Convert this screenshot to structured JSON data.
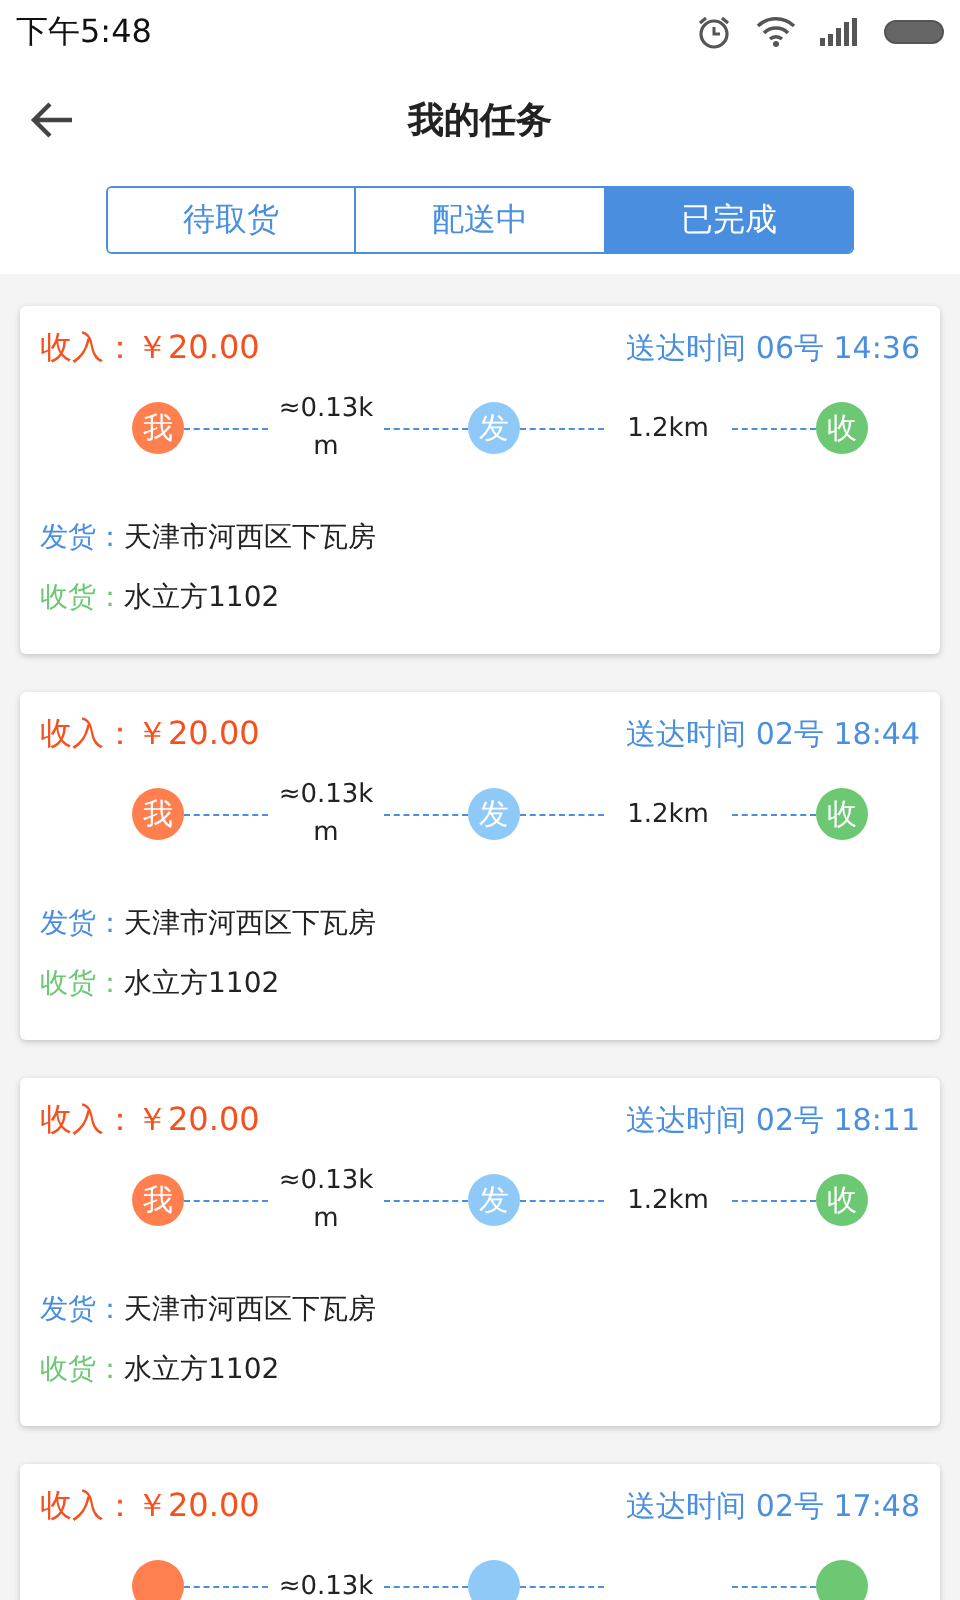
{
  "status_bar": {
    "time": "下午5:48"
  },
  "header": {
    "title": "我的任务"
  },
  "tabs": [
    {
      "label": "待取货",
      "selected": false
    },
    {
      "label": "配送中",
      "selected": false
    },
    {
      "label": "已完成",
      "selected": true
    }
  ],
  "orders": [
    {
      "income_label": "收入：",
      "income": "￥20.00",
      "delivery_time": "送达时间 06号 14:36",
      "route": {
        "me": "我",
        "distance_to_pickup": "≈0.13km",
        "pickup": "发",
        "distance_to_dropoff": "1.2km",
        "dropoff": "收"
      },
      "sender_label": "发货：",
      "sender": "天津市河西区下瓦房",
      "receiver_label": "收货：",
      "receiver": "水立方1102"
    },
    {
      "income_label": "收入：",
      "income": "￥20.00",
      "delivery_time": "送达时间 02号 18:44",
      "route": {
        "me": "我",
        "distance_to_pickup": "≈0.13km",
        "pickup": "发",
        "distance_to_dropoff": "1.2km",
        "dropoff": "收"
      },
      "sender_label": "发货：",
      "sender": "天津市河西区下瓦房",
      "receiver_label": "收货：",
      "receiver": "水立方1102"
    },
    {
      "income_label": "收入：",
      "income": "￥20.00",
      "delivery_time": "送达时间 02号 18:11",
      "route": {
        "me": "我",
        "distance_to_pickup": "≈0.13km",
        "pickup": "发",
        "distance_to_dropoff": "1.2km",
        "dropoff": "收"
      },
      "sender_label": "发货：",
      "sender": "天津市河西区下瓦房",
      "receiver_label": "收货：",
      "receiver": "水立方1102"
    },
    {
      "income_label": "收入：",
      "income": "￥20.00",
      "delivery_time": "送达时间 02号 17:48",
      "route": {
        "distance_to_pickup": "≈0.13k"
      }
    }
  ]
}
